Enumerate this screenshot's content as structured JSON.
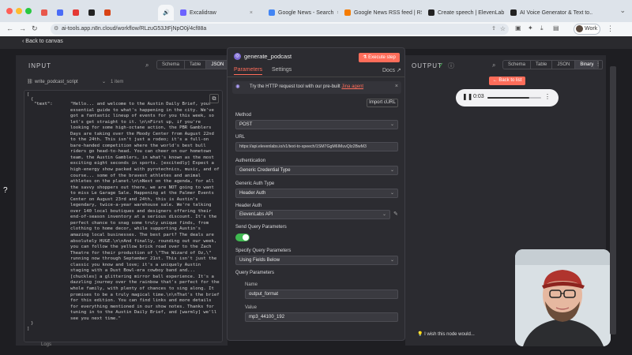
{
  "browser": {
    "tabs": [
      {
        "label": "",
        "color": "#e8574b"
      },
      {
        "label": "",
        "color": "#4a6cf7"
      },
      {
        "label": "",
        "color": "#e53935"
      },
      {
        "label": "",
        "color": "#222222"
      },
      {
        "label": "",
        "color": "#d84315"
      },
      {
        "label": "Excalidraw",
        "color": "#6c63ff"
      },
      {
        "label": "Google News - Search",
        "color": "#4285f4"
      },
      {
        "label": "Google News RSS feed | RSS...",
        "color": "#f57c00"
      },
      {
        "label": "Create speech | ElevenLabs D...",
        "color": "#222222"
      },
      {
        "label": "AI Voice Generator & Text to...",
        "color": "#222222"
      }
    ],
    "url": "ai-tools.app.n8n.cloud/workflow/RLzuG53JtFjNpO0j/4cf88a",
    "profile_label": "Work"
  },
  "app": {
    "back_label": "Back to canvas"
  },
  "input_panel": {
    "title": "INPUT",
    "view_tabs": [
      "Schema",
      "Table",
      "JSON"
    ],
    "active_view": "JSON",
    "node_select": "write_podcast_script",
    "item_count": "1 item",
    "json_key": "\"text\":",
    "json_text": "\"Hello... and welcome to the Austin Daily Brief, your essential guide to what's happening in the city. We've got a fantastic lineup of events for you this week, so let's get straight to it. \\n\\nFirst up, if you're looking for some high-octane action, the PBR Gamblers Days are taking over the Moody Center from August 22nd to the 24th. This isn't just a rodeo; it's a full-on bare-handed competition where the world's best bull riders go head-to-head. You can cheer on our hometown team, the Austin Gamblers, in what's known as the most exciting eight seconds in sports. [excitedly] Expect a high-energy show packed with pyrotechnics, music, and of course... some of the bravest athletes and animal athletes on the planet.\\n\\nNext on the agenda, for all the savvy shoppers out there, we are NOT going to want to miss Le Garage Sale. Happening at the Palmer Events Center on August 23rd and 24th, this is Austin's legendary, twice-a-year warehouse sale. We're talking over 140 local boutiques and designers offering their end-of-season inventory at a serious discount. It's the perfect chance to snag some truly unique finds, from clothing to home decor, while supporting Austin's amazing local businesses. The best part? The deals are absolutely HUGE.\\n\\nAnd finally, rounding out our week, you can follow the yellow brick road over to the Zach Theatre for their production of \\\"The Wizard of Oz,\\\" running now through September 21st. This isn't just the classic you know and love; it's a uniquely Austin staging with a Dust Bowl-era cowboy band and... [chuckles] a glittering mirror ball experience. It's a dazzling journey over the rainbow that's perfect for the whole family, with plenty of chances to sing along. It promises to be a truly magical time.\\n\\nThat's the brief for this edition. You can find links and more details for everything mentioned in our show notes. Thanks for tuning in to the Austin Daily Brief, and [warmly] we'll see you next time.\""
  },
  "modal": {
    "node_name": "generate_podcast",
    "execute_label": "Execute step",
    "tabs": [
      "Parameters",
      "Settings"
    ],
    "docs_label": "Docs",
    "tip_text": "Try the HTTP request tool with our pre-built",
    "tip_link": "Jina agent",
    "import_label": "Import cURL",
    "fields": {
      "method_label": "Method",
      "method_value": "POST",
      "url_label": "URL",
      "url_value": "https://api.elevenlabs.io/v1/text-to-speech/1SM7GgM6IMuvQlz2BwM3",
      "auth_label": "Authentication",
      "auth_value": "Generic Credential Type",
      "generic_auth_label": "Generic Auth Type",
      "generic_auth_value": "Header Auth",
      "header_auth_label": "Header Auth",
      "header_auth_value": "ElevenLabs API",
      "send_query_label": "Send Query Parameters",
      "send_query_on": true,
      "specify_query_label": "Specify Query Parameters",
      "specify_query_value": "Using Fields Below",
      "query_params_label": "Query Parameters",
      "name_label": "Name",
      "name_value": "output_format",
      "value_label": "Value",
      "value_value": "mp3_44100_192"
    }
  },
  "output_panel": {
    "title": "OUTPUT",
    "view_tabs": [
      "Schema",
      "Table",
      "JSON",
      "Binary"
    ],
    "active_view": "Binary",
    "back_to_list": "← Back to list",
    "audio_time": "0:03",
    "audio_progress": 0.78
  },
  "footer": {
    "note": "I wish this node would...",
    "logs_label": "Logs"
  }
}
